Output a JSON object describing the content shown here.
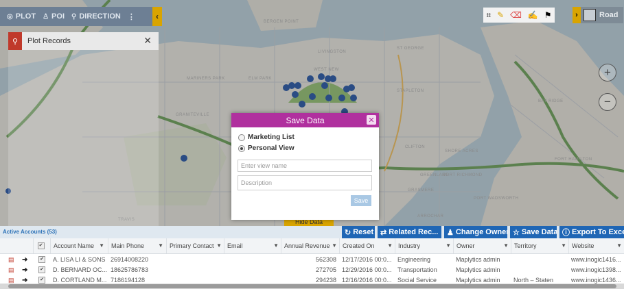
{
  "toolbar": {
    "plot_label": "PLOT",
    "poi_label": "POI",
    "direction_label": "DIRECTION",
    "more": "⋮",
    "collapse": "‹"
  },
  "plot_panel": {
    "title": "Plot Records",
    "close": "✕"
  },
  "map_labels": [
    "BERGEN POINT",
    "ELM PARK",
    "MARINERS PARK",
    "LIVINGSTON",
    "WEST NEW",
    "ST GEORGE",
    "GRANITEVILLE",
    "CLIFTON",
    "SHORE ACRES",
    "STAPLETON",
    "ARROCHAR",
    "BAY RIDGE",
    "FORT HAMILTON",
    "TRAVIS",
    "PORT RICHMOND",
    "GRASMERE",
    "PORT WADSWORTH",
    "GREENLANE"
  ],
  "road_control": {
    "label": "Road",
    "toggle": "›"
  },
  "zoom": {
    "in": "+",
    "out": "−"
  },
  "hide_data": "Hide Data",
  "modal": {
    "title": "Save Data",
    "close": "✕",
    "option_marketing": "Marketing List",
    "option_personal": "Personal View",
    "view_name_placeholder": "Enter view name",
    "description_placeholder": "Description",
    "save_label": "Save"
  },
  "grid": {
    "section_label": "Active Accounts (53)",
    "actions": [
      "Reset",
      "Related Rec...",
      "Change Owner",
      "Save Data",
      "Export To Excel"
    ],
    "columns": [
      "Account Name",
      "Main Phone",
      "Primary Contact",
      "Email",
      "Annual Revenue",
      "Created On",
      "Industry",
      "Owner",
      "Territory",
      "Website"
    ],
    "rows": [
      [
        "A. LISA LI & SONS",
        "26914008220",
        "",
        "",
        "562308",
        "12/17/2016 00:0...",
        "Engineering",
        "Maplytics admin",
        "",
        "www.inogic1416..."
      ],
      [
        "D. BERNARD OC...",
        "18625786783",
        "",
        "",
        "272705",
        "12/29/2016 00:0...",
        "Transportation",
        "Maplytics admin",
        "",
        "www.inogic1398..."
      ],
      [
        "D. CORTLAND M...",
        "7186194128",
        "",
        "",
        "294238",
        "12/16/2016 00:0...",
        "Social Service",
        "Maplytics admin",
        "North – Staten",
        "www.inogic1436..."
      ]
    ]
  },
  "colors": {
    "modal_header": "#b0309e",
    "action_button": "#1f66b5",
    "accent": "#d9a400",
    "toolbar": "#6d7f94"
  }
}
